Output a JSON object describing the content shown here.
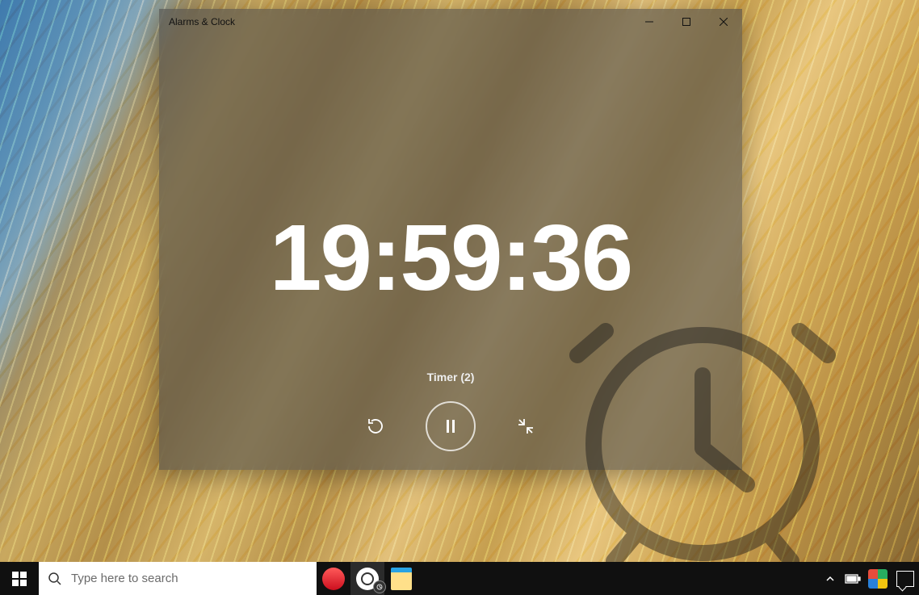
{
  "window": {
    "title": "Alarms & Clock",
    "timer_value": "19:59:36",
    "timer_label": "Timer (2)"
  },
  "taskbar": {
    "search_placeholder": "Type here to search"
  },
  "icons": {
    "minimize": "minimize",
    "maximize": "maximize",
    "close": "close",
    "reset": "reset",
    "pause": "pause",
    "collapse": "collapse",
    "start": "start",
    "search": "search",
    "opera": "opera",
    "yandex": "yandex",
    "explorer": "file-explorer",
    "tray_up": "tray-expand",
    "battery": "battery",
    "updates": "updates",
    "action_center": "action-center"
  }
}
